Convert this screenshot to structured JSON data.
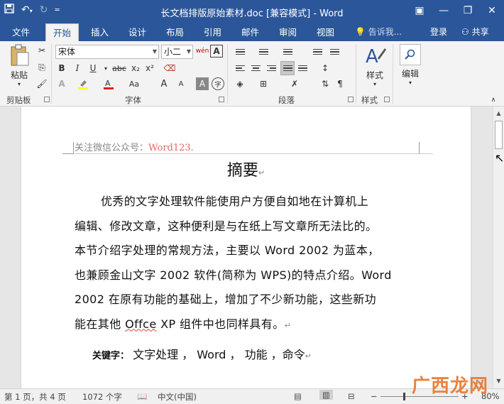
{
  "window": {
    "title": "长文档排版原始素材.doc [兼容模式] - Word",
    "qat_icons": [
      "save-icon",
      "undo-icon",
      "redo-icon",
      "customize-icon"
    ],
    "controls": [
      "ribbon-display-icon",
      "minimize-icon",
      "restore-icon",
      "close-icon"
    ]
  },
  "tabs": {
    "file": "文件",
    "home": "开始",
    "insert": "插入",
    "design": "设计",
    "layout": "布局",
    "references": "引用",
    "mailings": "邮件",
    "review": "审阅",
    "view": "视图",
    "tellme": "告诉我...",
    "login": "登录",
    "share": "共享"
  },
  "ribbon": {
    "clipboard": {
      "label": "剪贴板",
      "paste": "粘贴"
    },
    "font": {
      "label": "字体",
      "font_name": "宋体",
      "font_size": "小二",
      "bold": "B",
      "italic": "I",
      "underline": "U",
      "strike": "abc",
      "sub": "x₂",
      "sup": "x²",
      "grow": "A",
      "shrink": "A",
      "case": "Aa",
      "clear": "A"
    },
    "paragraph": {
      "label": "段落"
    },
    "styles": {
      "label": "样式",
      "button": "样式"
    },
    "editing": {
      "button": "编辑"
    }
  },
  "document": {
    "header": "关注微信公众号：",
    "header_highlight": "Word123.",
    "title": "摘要",
    "lines": [
      "优秀的文字处理软件能使用户方便自如地在计算机上",
      "编辑、修改文章，这种便利是与在纸上写文章所无法比",
      "本节介绍字处理的常规方法，主要以 Word 2002 为蓝本，",
      "也兼顾金山文字 2002 软件(简称为 WPS)的特点介绍。Word",
      "2002 在原有功能的基础上，增加了不少新功能，这些新功",
      "能在其他 "
    ],
    "line2_tail": "的。",
    "misspelled": "Offce",
    "last_tail": " XP 组件中也同样具有。",
    "keywords_label": "关键字：",
    "keywords": "文字处理 ， Word ， 功能 ，命令"
  },
  "statusbar": {
    "page": "第 1 页，共 4 页",
    "words": "1072 个字",
    "language": "中文(中国)",
    "zoom": "80%"
  },
  "zoom_level": 0.8,
  "watermark": "广西龙网",
  "colors": {
    "titlebar": "#2b579a",
    "ribbon": "#f3f3f3",
    "page": "#ffffff",
    "header_highlight": "#e06666",
    "watermark": "#e8762b"
  }
}
